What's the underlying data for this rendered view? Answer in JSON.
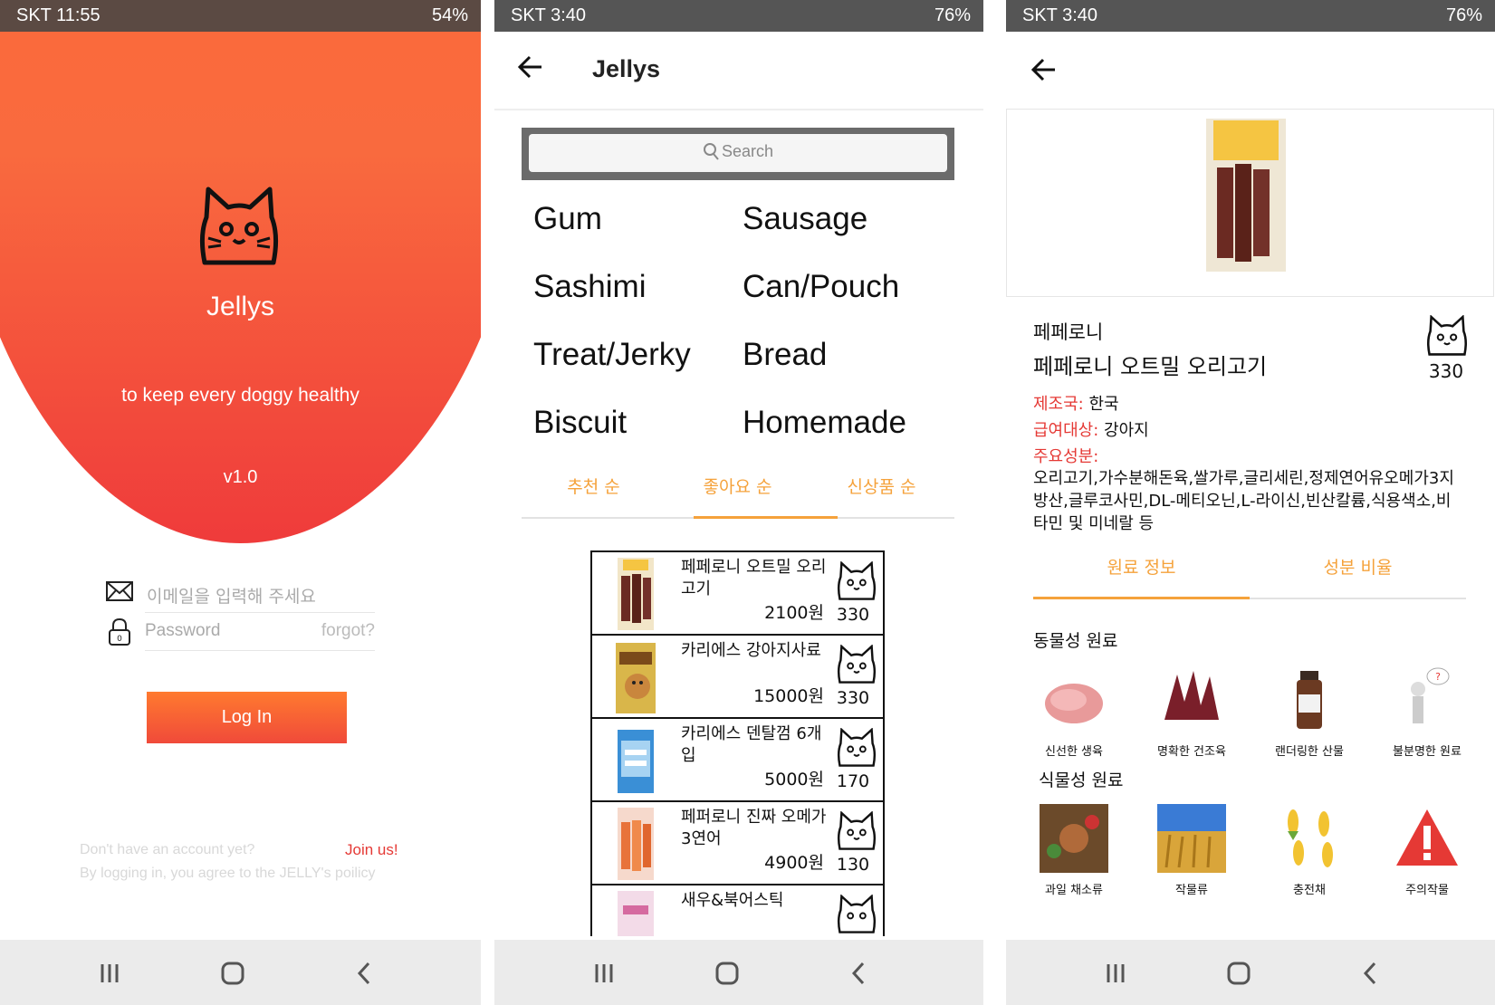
{
  "screens": {
    "login": {
      "status": {
        "left": "SKT 11:55",
        "right": "54%"
      },
      "app_name": "Jellys",
      "tagline": "to keep every doggy healthy",
      "version": "v1.0",
      "email_placeholder": "이메일을 입력해 주세요",
      "password_placeholder": "Password",
      "forgot_label": "forgot?",
      "login_label": "Log In",
      "no_account_text": "Don't have an account yet?",
      "join_label": "Join us!",
      "policy_text": "By logging in, you agree to the JELLY's poilicy",
      "colors": {
        "gradient_top": "#ff6b35",
        "gradient_bottom": "#ef3b3b",
        "join": "#e53935"
      }
    },
    "list": {
      "status": {
        "left": "SKT 3:40",
        "right": "76%"
      },
      "title": "Jellys",
      "search_placeholder": "Search",
      "categories": [
        "Gum",
        "Sausage",
        "Sashimi",
        "Can/Pouch",
        "Treat/Jerky",
        "Bread",
        "Biscuit",
        "Homemade"
      ],
      "sort_tabs": [
        "추천 순",
        "좋아요 순",
        "신상품 순"
      ],
      "active_sort": "좋아요 순",
      "products": [
        {
          "name": "페페로니 오트밀 오리고기",
          "price": "2100원",
          "likes": "330"
        },
        {
          "name": "카리에스 강아지사료",
          "price": "15000원",
          "likes": "330"
        },
        {
          "name": "카리에스 덴탈껌 6개입",
          "price": "5000원",
          "likes": "170"
        },
        {
          "name": "페퍼로니 진짜 오메가3연어",
          "price": "4900원",
          "likes": "130"
        },
        {
          "name": "새우&북어스틱",
          "price": "",
          "likes": ""
        }
      ],
      "colors": {
        "accent": "#f5a23b"
      }
    },
    "detail": {
      "status": {
        "left": "SKT 3:40",
        "right": "76%"
      },
      "brand": "페페로니",
      "product_name": "페페로니 오트밀 오리고기",
      "likes": "330",
      "origin_label": "제조국:",
      "origin_value": "한국",
      "target_label": "급여대상:",
      "target_value": "강아지",
      "ingredients_label": "주요성분:",
      "ingredients_value": "오리고기,가수분해돈육,쌀가루,글리세린,정제연어유오메가3지방산,글루코사민,DL-메티오닌,L-라이신,빈산칼륨,식용색소,비타민 및 미네랄 등",
      "tabs": [
        "원료 정보",
        "성분 비율"
      ],
      "animal_section": "동물성 원료",
      "animal_items": [
        "신선한 생육",
        "명확한 건조육",
        "랜더링한 산물",
        "불분명한 원료"
      ],
      "plant_section": "식물성 원료",
      "plant_items": [
        "과일 채소류",
        "작물류",
        "충전채",
        "주의작물"
      ],
      "colors": {
        "label_red": "#e53935",
        "accent": "#f5a23b"
      }
    }
  }
}
